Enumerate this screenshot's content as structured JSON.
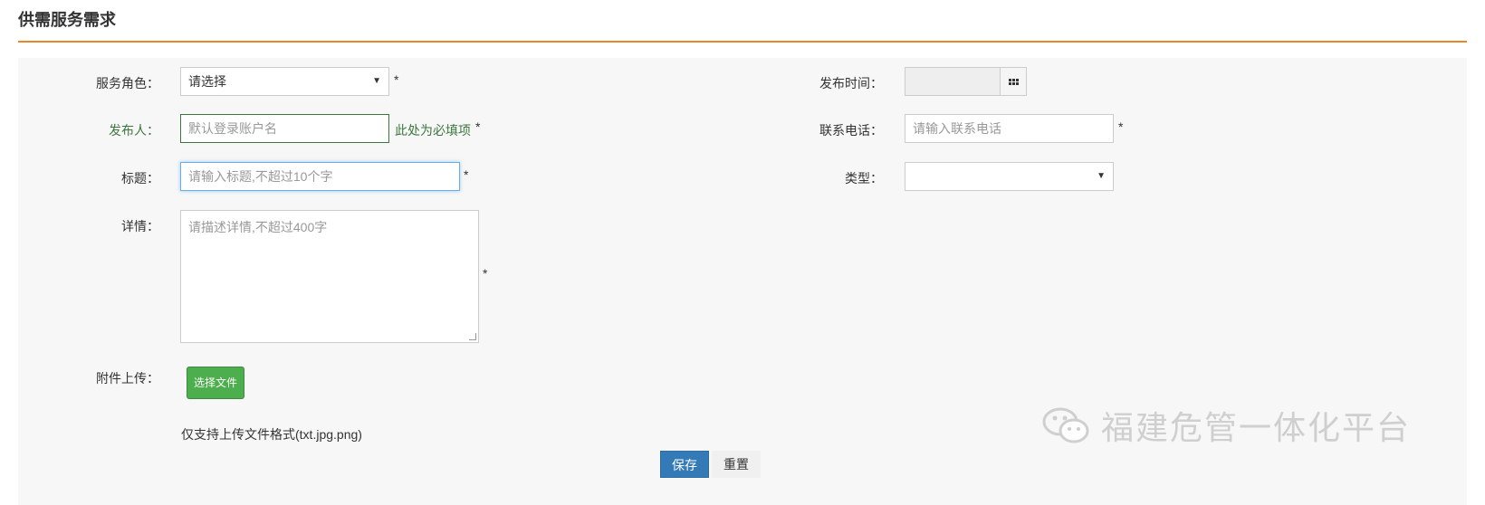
{
  "page": {
    "title": "供需服务需求"
  },
  "form": {
    "role": {
      "label": "服务角色：",
      "value": "请选择",
      "required": "*"
    },
    "publish_time": {
      "label": "发布时间：",
      "value": ""
    },
    "publisher": {
      "label": "发布人：",
      "placeholder": "默认登录账户名",
      "hint": "此处为必填项",
      "required": "*"
    },
    "phone": {
      "label": "联系电话：",
      "placeholder": "请输入联系电话",
      "required": "*"
    },
    "title": {
      "label": "标题：",
      "placeholder": "请输入标题,不超过10个字",
      "required": "*"
    },
    "type": {
      "label": "类型：",
      "value": ""
    },
    "detail": {
      "label": "详情：",
      "placeholder": "请描述详情,不超过400字",
      "required": "*"
    },
    "attachment": {
      "label": "附件上传：",
      "button": "选择文件",
      "note": "仅支持上传文件格式(txt.jpg.png)"
    }
  },
  "actions": {
    "save": "保存",
    "reset": "重置"
  },
  "watermark": {
    "text": "福建危管一体化平台"
  },
  "icons": [
    "dropdown-caret-icon",
    "calendar-grid-icon",
    "wechat-icon"
  ],
  "colors": {
    "accent": "#e8862c",
    "primary": "#337ab7",
    "success": "#4cae4c",
    "valid": "#3c763d"
  }
}
